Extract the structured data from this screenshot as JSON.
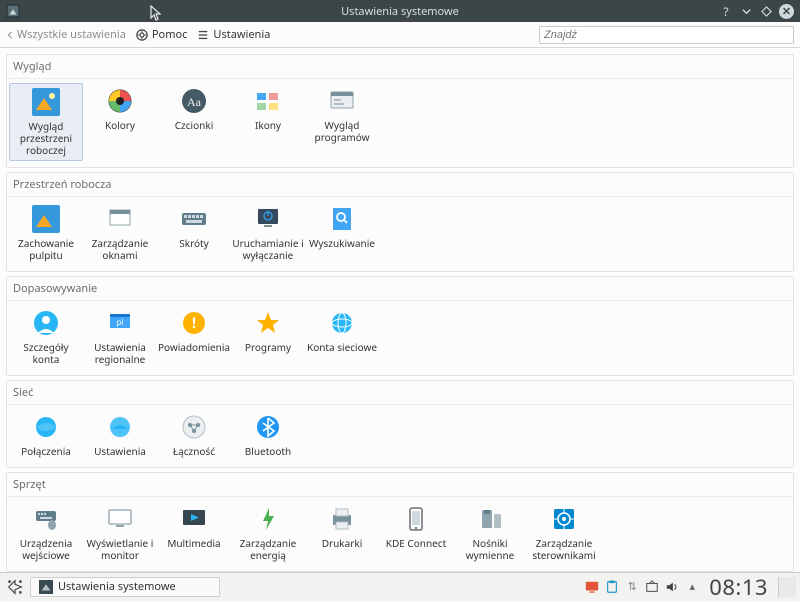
{
  "window": {
    "title": "Ustawienia systemowe"
  },
  "toolbar": {
    "back": "Wszystkie ustawienia",
    "help": "Pomoc",
    "settings": "Ustawienia",
    "search_placeholder": "Znajdź"
  },
  "sections": [
    {
      "title": "Wygląd",
      "items": [
        {
          "label": "Wygląd\nprzestrzeni\nroboczej",
          "icon": "workspace-theme",
          "selected": true
        },
        {
          "label": "Kolory",
          "icon": "colors"
        },
        {
          "label": "Czcionki",
          "icon": "fonts"
        },
        {
          "label": "Ikony",
          "icon": "icons"
        },
        {
          "label": "Wygląd\nprogramów",
          "icon": "app-style"
        }
      ]
    },
    {
      "title": "Przestrzeń robocza",
      "items": [
        {
          "label": "Zachowanie\npulpitu",
          "icon": "desktop-behavior"
        },
        {
          "label": "Zarządzanie\noknami",
          "icon": "window-management"
        },
        {
          "label": "Skróty",
          "icon": "shortcuts"
        },
        {
          "label": "Uruchamianie i\nwyłączanie",
          "icon": "startup-shutdown"
        },
        {
          "label": "Wyszukiwanie",
          "icon": "search"
        }
      ]
    },
    {
      "title": "Dopasowywanie",
      "items": [
        {
          "label": "Szczegóły\nkonta",
          "icon": "account"
        },
        {
          "label": "Ustawienia\nregionalne",
          "icon": "locale"
        },
        {
          "label": "Powiadomienia",
          "icon": "notifications"
        },
        {
          "label": "Programy",
          "icon": "applications"
        },
        {
          "label": "Konta sieciowe",
          "icon": "online-accounts"
        }
      ]
    },
    {
      "title": "Sieć",
      "items": [
        {
          "label": "Połączenia",
          "icon": "network-connections"
        },
        {
          "label": "Ustawienia",
          "icon": "network-settings"
        },
        {
          "label": "Łączność",
          "icon": "connectivity"
        },
        {
          "label": "Bluetooth",
          "icon": "bluetooth"
        }
      ]
    },
    {
      "title": "Sprzęt",
      "items": [
        {
          "label": "Urządzenia\nwejściowe",
          "icon": "input-devices"
        },
        {
          "label": "Wyświetlanie i\nmonitor",
          "icon": "display"
        },
        {
          "label": "Multimedia",
          "icon": "multimedia"
        },
        {
          "label": "Zarządzanie\nenergią",
          "icon": "power"
        },
        {
          "label": "Drukarki",
          "icon": "printers"
        },
        {
          "label": "KDE Connect",
          "icon": "kdeconnect"
        },
        {
          "label": "Nośniki\nwymienne",
          "icon": "removable"
        },
        {
          "label": "Zarządzanie\nsterownikami",
          "icon": "drivers"
        }
      ]
    }
  ],
  "taskbar": {
    "active_task": "Ustawienia systemowe",
    "clock": "08:13"
  }
}
